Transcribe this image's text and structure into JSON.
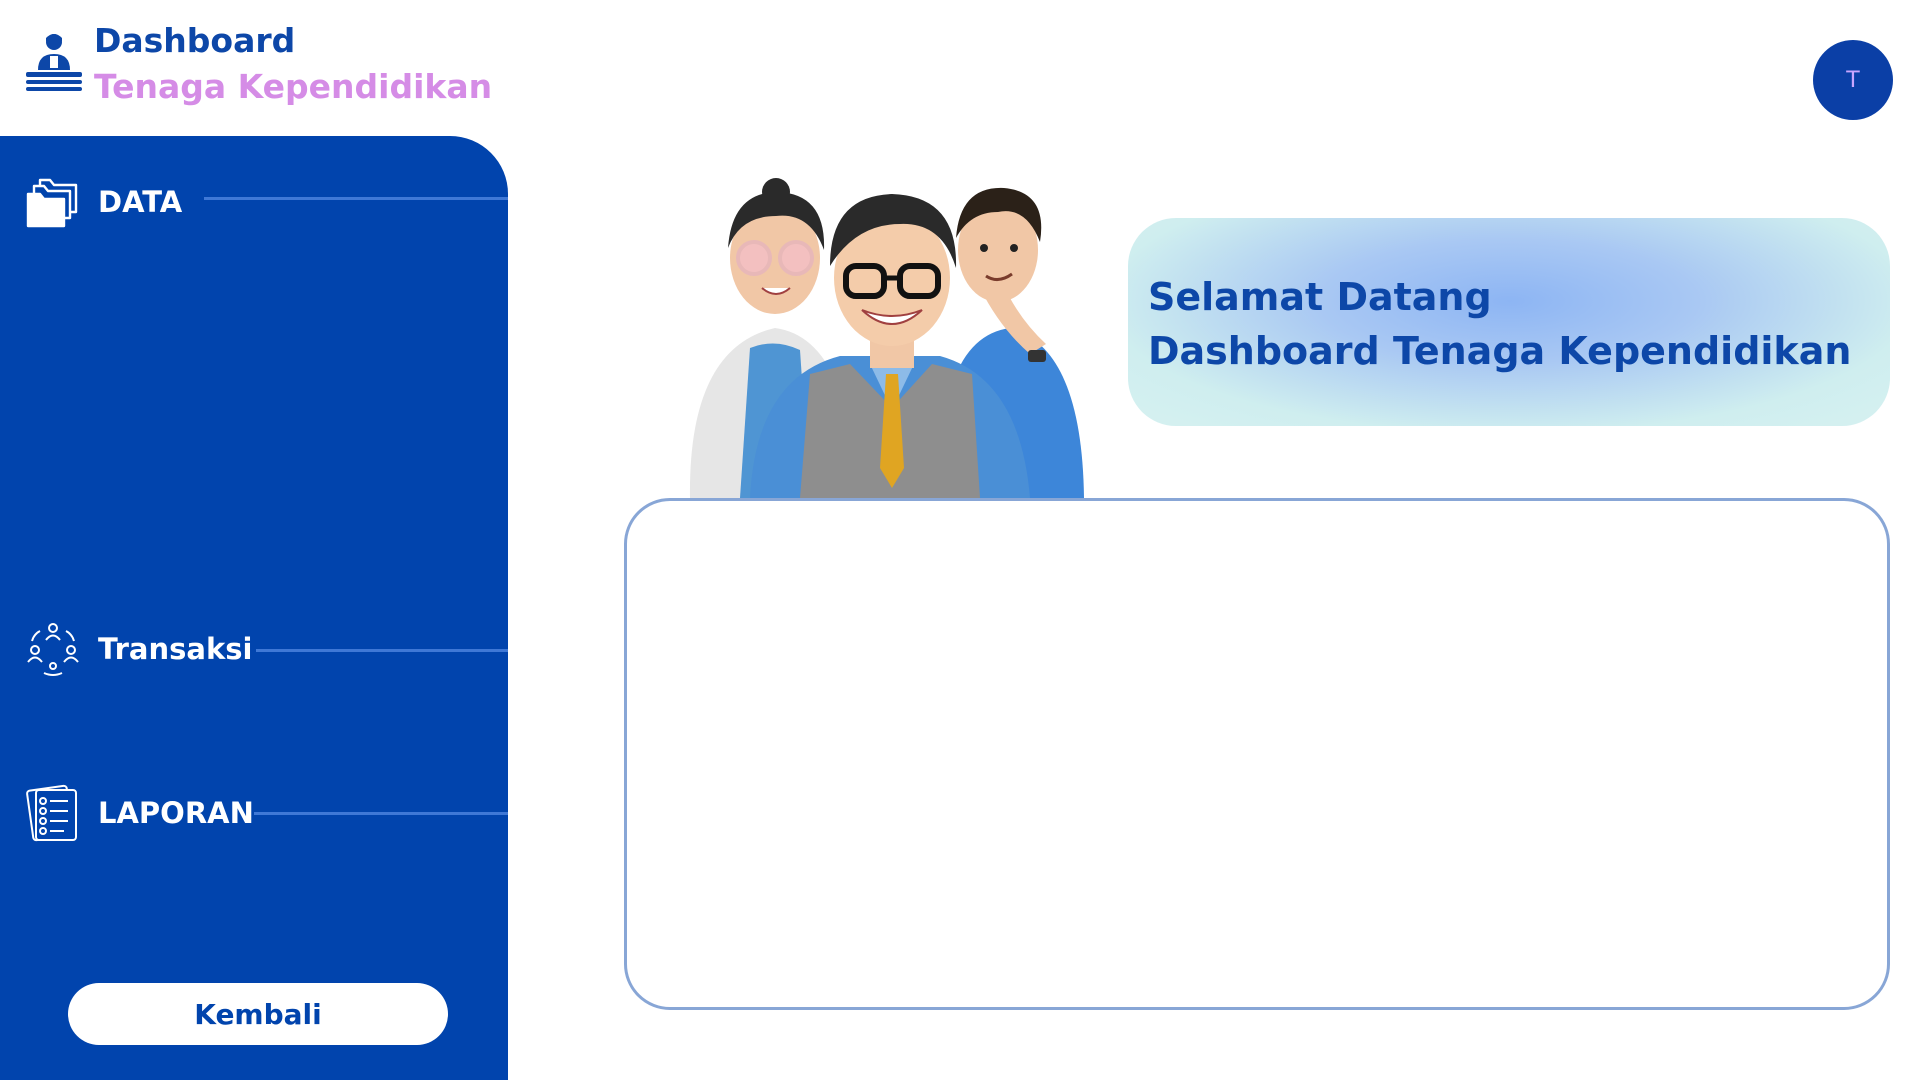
{
  "header": {
    "title_line1": "Dashboard",
    "title_line2": "Tenaga Kependidikan",
    "logo_icon": "teacher-desk-icon",
    "avatar_initial": "T"
  },
  "sidebar": {
    "items": [
      {
        "label": "DATA",
        "icon": "folder-icon"
      },
      {
        "label": "Transaksi",
        "icon": "people-exchange-icon"
      },
      {
        "label": "LAPORAN",
        "icon": "report-checklist-icon"
      }
    ],
    "back_label": "Kembali"
  },
  "main": {
    "welcome_line1": "Selamat Datang",
    "welcome_line2": "Dashboard Tenaga Kependidikan",
    "illustration": "three-staff-characters"
  },
  "colors": {
    "primary": "#0144ad",
    "title_blue": "#0d47a8",
    "subtitle_pink": "#d58ce6",
    "panel_border": "#88a6d6"
  }
}
